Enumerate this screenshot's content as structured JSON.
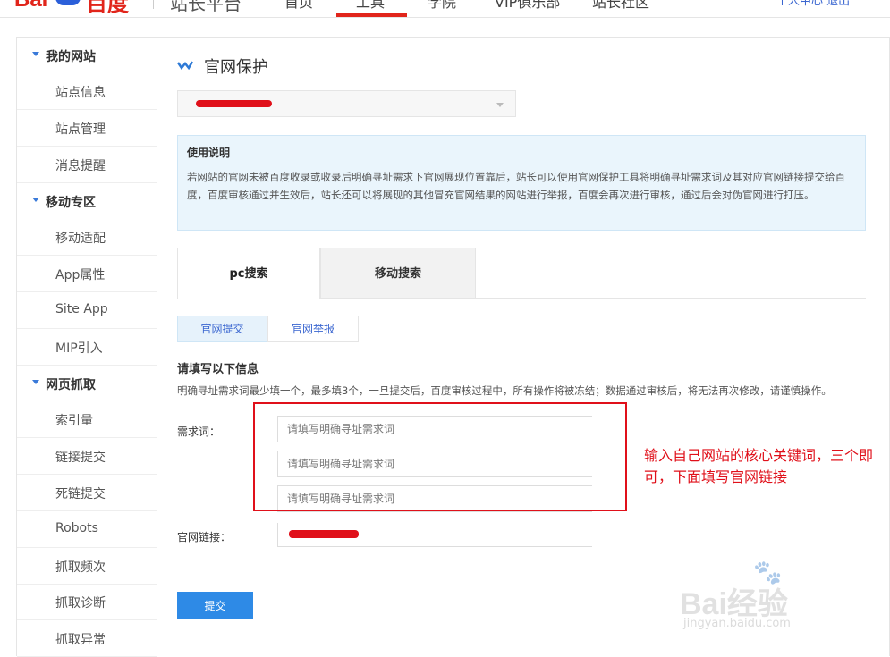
{
  "header": {
    "logo_text_bai": "Bai",
    "logo_text_cn": "百度",
    "platform_title": "站长平台",
    "nav": [
      "首页",
      "工具",
      "学院",
      "VIP俱乐部",
      "站长社区"
    ],
    "active_nav": "工具",
    "right_links": "个人中心  退出"
  },
  "sidebar": {
    "sections": [
      {
        "title": "我的网站",
        "items": [
          "站点信息",
          "站点管理",
          "消息提醒"
        ]
      },
      {
        "title": "移动专区",
        "items": [
          "移动适配",
          "App属性",
          "Site App",
          "MIP引入"
        ]
      },
      {
        "title": "网页抓取",
        "items": [
          "索引量",
          "链接提交",
          "死链提交",
          "Robots",
          "抓取频次",
          "抓取诊断",
          "抓取异常"
        ]
      }
    ]
  },
  "main": {
    "page_title": "官网保护",
    "site_select_value": "",
    "info": {
      "title": "使用说明",
      "body": "若网站的官网未被百度收录或收录后明确寻址需求下官网展现位置靠后，站长可以使用官网保护工具将明确寻址需求词及其对应官网链接提交给百度，百度审核通过并生效后，站长还可以将展现的其他冒充官网结果的网站进行举报，百度会再次进行审核，通过后会对伪官网进行打压。"
    },
    "tabs": [
      "pc搜索",
      "移动搜索"
    ],
    "subtabs": [
      "官网提交",
      "官网举报"
    ],
    "form": {
      "title": "请填写以下信息",
      "note": "明确寻址需求词最少填一个，最多填3个，一旦提交后，百度审核过程中，所有操作将被冻结；数据通过审核后，将无法再次修改，请谨慎操作。",
      "keyword_label": "需求词：",
      "keyword_placeholder": "请填写明确寻址需求词",
      "link_label": "官网链接：",
      "submit": "提交"
    },
    "annotation": "输入自己网站的核心关键词，三个即可，下面填写官网链接"
  },
  "watermark": {
    "brand": "Bai经验",
    "url": "jingyan.baidu.com"
  },
  "colors": {
    "brand_red": "#e1251b",
    "accent_blue": "#2e8ae6",
    "annotation_red": "#e0101a"
  }
}
